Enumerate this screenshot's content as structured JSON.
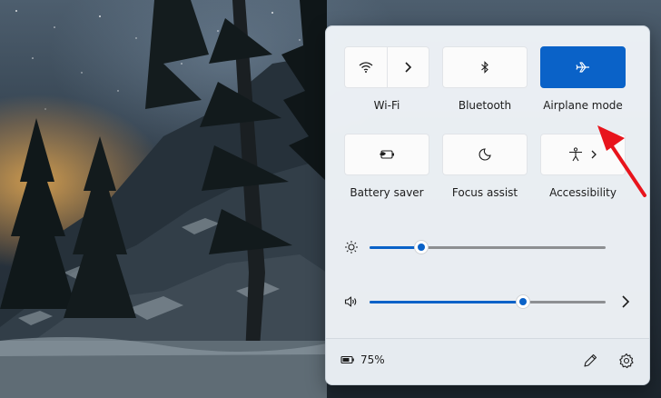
{
  "quick_settings": {
    "tiles": [
      {
        "id": "wifi",
        "label": "Wi-Fi",
        "icon": "wifi-icon",
        "active": false,
        "has_chevron": true
      },
      {
        "id": "bluetooth",
        "label": "Bluetooth",
        "icon": "bluetooth-icon",
        "active": false,
        "has_chevron": false
      },
      {
        "id": "airplane",
        "label": "Airplane mode",
        "icon": "airplane-icon",
        "active": true,
        "has_chevron": false
      },
      {
        "id": "battery-saver",
        "label": "Battery saver",
        "icon": "battery-saver-icon",
        "active": false,
        "has_chevron": false
      },
      {
        "id": "focus-assist",
        "label": "Focus assist",
        "icon": "moon-icon",
        "active": false,
        "has_chevron": false
      },
      {
        "id": "accessibility",
        "label": "Accessibility",
        "icon": "accessibility-icon",
        "active": false,
        "has_chevron": true
      }
    ],
    "brightness": {
      "icon": "brightness-icon",
      "value": 0.22
    },
    "volume": {
      "icon": "speaker-icon",
      "value": 0.65,
      "expand_icon": "chevron-right-icon"
    }
  },
  "footer": {
    "battery_icon": "battery-icon",
    "battery_text": "75%",
    "edit_icon": "pencil-icon",
    "settings_icon": "gear-icon"
  },
  "colors": {
    "accent": "#0a62c8",
    "annotation_arrow": "#e8141c"
  }
}
